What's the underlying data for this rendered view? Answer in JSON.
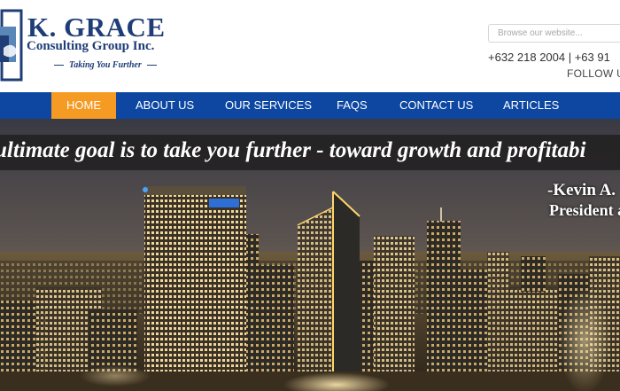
{
  "header": {
    "logo_icon": "kg-monogram-icon",
    "company_name": "K. GRACE",
    "company_sub": "Consulting Group Inc.",
    "tagline": "Taking You Further",
    "search_placeholder": "Browse our website...",
    "phone": "+632 218 2004 | +63 91",
    "follow": "FOLLOW US"
  },
  "nav": {
    "items": [
      {
        "label": "HOME",
        "active": true
      },
      {
        "label": "ABOUT US",
        "active": false
      },
      {
        "label": "OUR SERVICES",
        "active": false
      },
      {
        "label": "FAQS",
        "active": false
      },
      {
        "label": "CONTACT US",
        "active": false
      },
      {
        "label": "ARTICLES",
        "active": false
      }
    ]
  },
  "hero": {
    "quote": "ultimate goal is to take you further - toward growth and profitabi",
    "author": "-Kevin A.",
    "role": "President a"
  },
  "colors": {
    "brand_blue": "#1f3d77",
    "nav_blue": "#0d47a1",
    "active_orange": "#f59a23"
  }
}
